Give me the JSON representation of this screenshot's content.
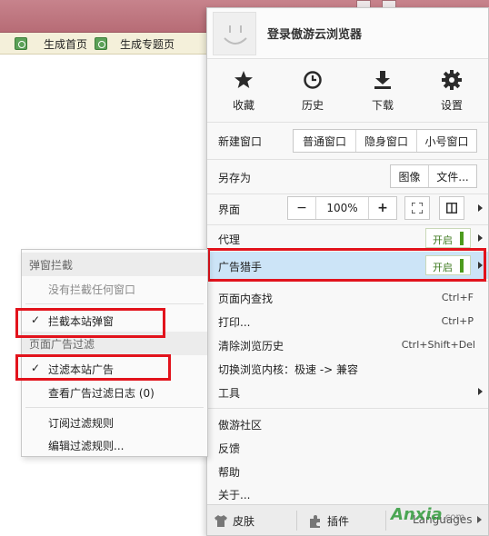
{
  "bookmarks": [
    {
      "label": "生成首页"
    },
    {
      "label": "生成专题页"
    }
  ],
  "menu": {
    "login_text": "登录傲游云浏览器",
    "quick_actions": [
      {
        "label": "收藏",
        "icon": "star-icon"
      },
      {
        "label": "历史",
        "icon": "clock-icon"
      },
      {
        "label": "下载",
        "icon": "download-icon"
      },
      {
        "label": "设置",
        "icon": "gear-icon"
      }
    ],
    "new_window": {
      "label": "新建窗口",
      "normal": "普通窗口",
      "private": "隐身窗口",
      "mini": "小号窗口"
    },
    "save_as": {
      "label": "另存为",
      "image": "图像",
      "file": "文件..."
    },
    "interface": {
      "label": "界面",
      "zoom_out": "−",
      "zoom": "100%",
      "zoom_in": "+"
    },
    "proxy": {
      "label": "代理",
      "state": "开启"
    },
    "adhunter": {
      "label": "广告猎手",
      "state": "开启"
    },
    "find": {
      "label": "页面内查找",
      "shortcut": "Ctrl+F"
    },
    "print": {
      "label": "打印...",
      "shortcut": "Ctrl+P"
    },
    "clear_history": {
      "label": "清除浏览历史",
      "shortcut": "Ctrl+Shift+Del"
    },
    "switch_kernel": {
      "label": "切换浏览内核：极速 -> 兼容"
    },
    "tools": {
      "label": "工具"
    },
    "community": {
      "label": "傲游社区"
    },
    "feedback": {
      "label": "反馈"
    },
    "help": {
      "label": "帮助"
    },
    "about": {
      "label": "关于..."
    },
    "bottom": {
      "skin": "皮肤",
      "plugins": "插件",
      "languages": "Languages"
    }
  },
  "submenu": {
    "popup_header": "弹窗拦截",
    "no_blocked": "没有拦截任何窗口",
    "block_popups": "拦截本站弹窗",
    "ad_header": "页面广告过滤",
    "filter_ads": "过滤本站广告",
    "filter_log": "查看广告过滤日志 (0)",
    "subscribe": "订阅过滤规则",
    "edit_rules": "编辑过滤规则..."
  },
  "watermark": {
    "brand": "Anxia",
    "domain": ".com"
  },
  "colors": {
    "highlight": "#cce4f7",
    "red_box": "#e2131c",
    "toggle_green": "#4d9b1e"
  }
}
